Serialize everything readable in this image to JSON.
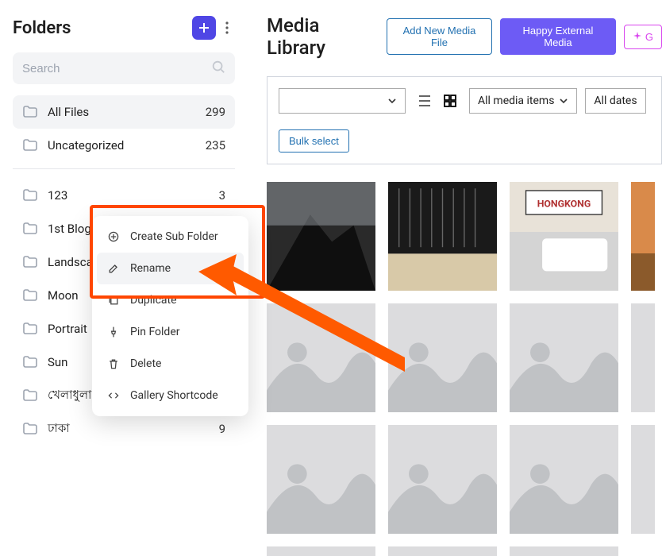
{
  "sidebar": {
    "title": "Folders",
    "search_placeholder": "Search",
    "main_items": [
      {
        "label": "All Files",
        "count": "299",
        "active": true
      },
      {
        "label": "Uncategorized",
        "count": "235",
        "active": false
      }
    ],
    "folders": [
      {
        "label": "123",
        "count": "3"
      },
      {
        "label": "1st Blog",
        "count": ""
      },
      {
        "label": "Landscape",
        "count": ""
      },
      {
        "label": "Moon",
        "count": ""
      },
      {
        "label": "Portrait",
        "count": ""
      },
      {
        "label": "Sun",
        "count": ""
      },
      {
        "label": "খেলাধুলা",
        "count": ""
      },
      {
        "label": "ঢাকা",
        "count": "9"
      }
    ]
  },
  "context_menu": {
    "items": [
      {
        "label": "Create Sub Folder",
        "icon": "plus-circle"
      },
      {
        "label": "Rename",
        "icon": "edit",
        "hover": true
      },
      {
        "label": "Duplicate",
        "icon": "copy"
      },
      {
        "label": "Pin Folder",
        "icon": "pin"
      },
      {
        "label": "Delete",
        "icon": "trash"
      },
      {
        "label": "Gallery Shortcode",
        "icon": "code"
      }
    ]
  },
  "main": {
    "title": "Media Library",
    "add_btn": "Add New Media File",
    "ext_btn": "Happy External Media",
    "gen_btn": "G",
    "filter_media": "All media items",
    "filter_dates": "All dates",
    "bulk_btn": "Bulk select"
  }
}
